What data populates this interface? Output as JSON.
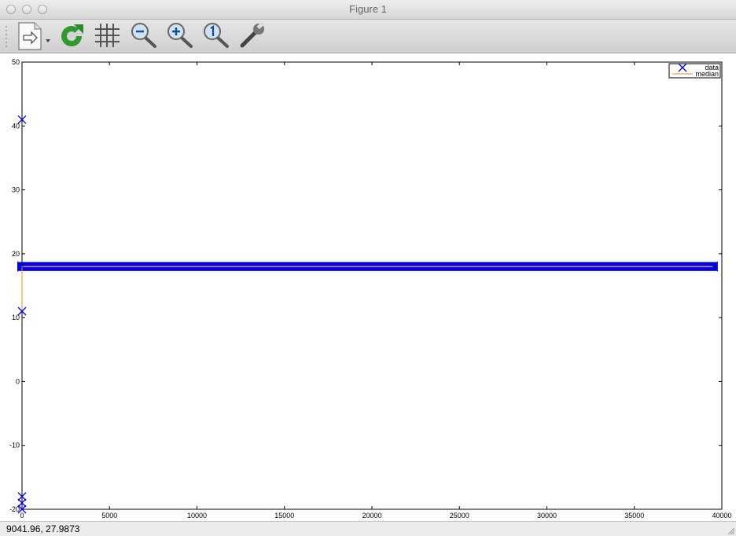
{
  "window": {
    "title": "Figure 1"
  },
  "toolbar": {
    "buttons": [
      {
        "name": "export-button",
        "icon": "document-arrow-icon"
      },
      {
        "name": "refresh-button",
        "icon": "refresh-icon"
      },
      {
        "name": "grid-button",
        "icon": "grid-icon"
      },
      {
        "name": "zoom-out-button",
        "icon": "zoom-out-icon"
      },
      {
        "name": "zoom-in-button",
        "icon": "zoom-in-icon"
      },
      {
        "name": "zoom-reset-button",
        "icon": "zoom-one-icon"
      },
      {
        "name": "settings-button",
        "icon": "wrench-icon"
      }
    ]
  },
  "status": {
    "coordinates": "9041.96,  27.9873"
  },
  "chart_data": {
    "type": "scatter",
    "xlim": [
      0,
      40000
    ],
    "ylim": [
      -20,
      50
    ],
    "x_ticks": [
      5000,
      10000,
      15000,
      20000,
      25000,
      30000,
      35000,
      40000
    ],
    "x_tick_labels": [
      "5000",
      "10000",
      "15000",
      "20000",
      "25000",
      "30000",
      "35000",
      "40000"
    ],
    "x_zero_label": "0",
    "y_ticks": [
      -20,
      -10,
      0,
      10,
      20,
      30,
      40,
      50
    ],
    "y_tick_labels": [
      "-20",
      "-10",
      "0",
      "10",
      "20",
      "30",
      "40",
      "50"
    ],
    "legend_position": "top-right",
    "series": [
      {
        "name": "data",
        "marker": "x",
        "color": "#0000ff",
        "dense_band": {
          "x_start": 0,
          "x_end": 39500,
          "y_center": 18,
          "y_min": 17.3,
          "y_max": 18.7
        },
        "points": [
          {
            "x": 0,
            "y": 41
          },
          {
            "x": 0,
            "y": 11
          },
          {
            "x": 0,
            "y": -18
          },
          {
            "x": 0,
            "y": -19
          },
          {
            "x": 0,
            "y": -20
          }
        ]
      },
      {
        "name": "median",
        "line": true,
        "color": "#ff8c00",
        "x": [
          0,
          0,
          150,
          39500
        ],
        "y": [
          11,
          18,
          18,
          18
        ]
      }
    ],
    "colors": {
      "data": "#0000ff",
      "median": "#ff8c00",
      "band": "#0000ee"
    }
  }
}
